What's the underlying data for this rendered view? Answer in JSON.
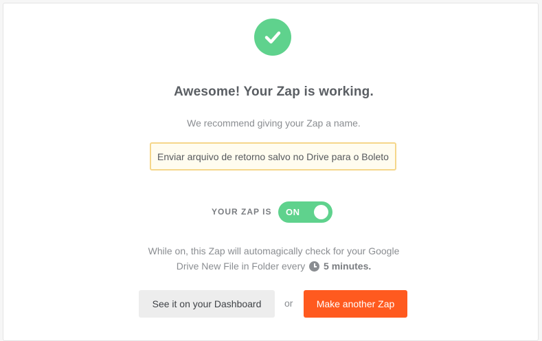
{
  "success": {
    "icon": "checkmark-icon",
    "title": "Awesome! Your Zap is working.",
    "subtitle": "We recommend giving your Zap a name."
  },
  "zap_name": {
    "value": "Enviar arquivo de retorno salvo no Drive para o Boleto"
  },
  "status": {
    "label": "YOUR ZAP IS",
    "toggle_text": "ON",
    "is_on": true
  },
  "description": {
    "line1": "While on, this Zap will automagically check for your Google",
    "line2_prefix": "Drive New File in Folder every",
    "clock_icon": "clock-icon",
    "interval": "5 minutes."
  },
  "actions": {
    "dashboard_label": "See it on your Dashboard",
    "or_text": "or",
    "make_label": "Make another Zap"
  },
  "colors": {
    "accent_green": "#5fd28d",
    "primary_orange": "#ff5a1f",
    "input_border": "#f5d68a"
  }
}
